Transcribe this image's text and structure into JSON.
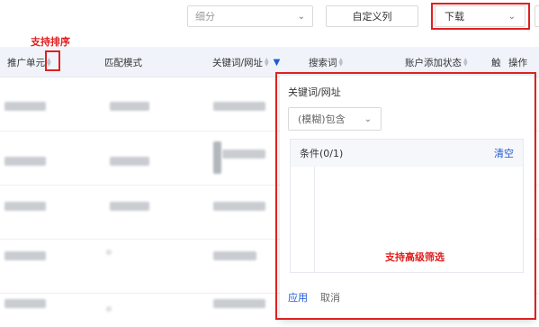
{
  "toolbar": {
    "segment_placeholder": "细分",
    "custom_columns_label": "自定义列",
    "download_label": "下载"
  },
  "annotations": {
    "sort_support": "支持排序",
    "advanced_filter": "支持高级筛选"
  },
  "table": {
    "columns": [
      "推广单元",
      "匹配模式",
      "关键词/网址",
      "搜索词",
      "账户添加状态",
      "触",
      "操作"
    ]
  },
  "filter_popover": {
    "title": "关键词/网址",
    "match_select_value": "(模糊)包含",
    "conditions_title": "条件(0/1)",
    "clear_label": "清空",
    "apply_label": "应用",
    "cancel_label": "取消"
  },
  "colors": {
    "accent": "#1f5ad6",
    "annotation_red": "#e02020",
    "header_bg": "#f0f4fa"
  }
}
